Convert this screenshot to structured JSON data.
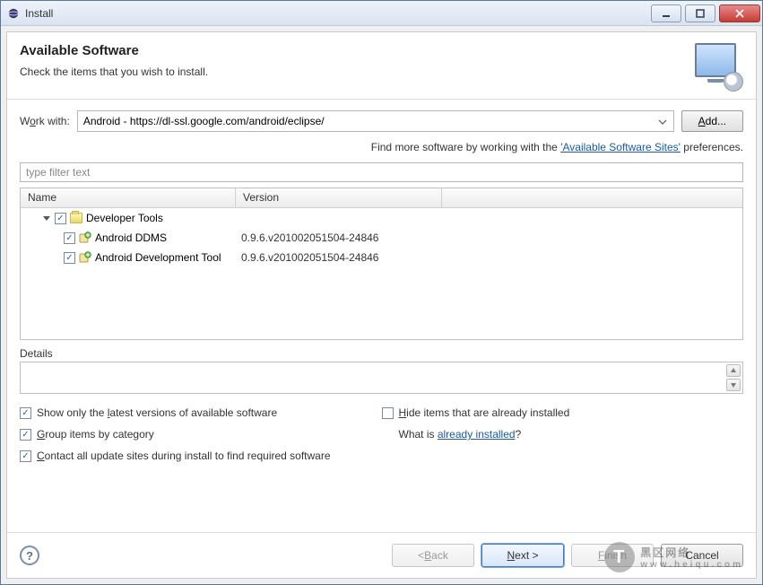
{
  "window": {
    "title": "Install"
  },
  "header": {
    "title": "Available Software",
    "subtitle": "Check the items that you wish to install."
  },
  "work": {
    "label": "Work with:",
    "value": "Android - https://dl-ssl.google.com/android/eclipse/",
    "add_label": "Add..."
  },
  "findline": {
    "prefix": "Find more software by working with the ",
    "link": "'Available Software Sites'",
    "suffix": " preferences."
  },
  "filter": {
    "placeholder": "type filter text"
  },
  "columns": {
    "name": "Name",
    "version": "Version"
  },
  "tree": {
    "group_label": "Developer Tools",
    "items": [
      {
        "name": "Android DDMS",
        "version": "0.9.6.v201002051504-24846"
      },
      {
        "name": "Android Development Tool",
        "version": "0.9.6.v201002051504-24846"
      }
    ]
  },
  "details": {
    "label": "Details"
  },
  "options": {
    "show_latest": "Show only the latest versions of available software",
    "group_by_cat": "Group items by category",
    "contact_sites": "Contact all update sites during install to find required software",
    "hide_installed": "Hide items that are already installed",
    "what_is_prefix": "What is ",
    "what_is_link": "already installed",
    "what_is_suffix": "?"
  },
  "buttons": {
    "back": "< Back",
    "next": "Next >",
    "finish": "Finish",
    "cancel": "Cancel"
  },
  "watermark": {
    "main": "黑区网络",
    "sub": "www.heiqu.com"
  }
}
